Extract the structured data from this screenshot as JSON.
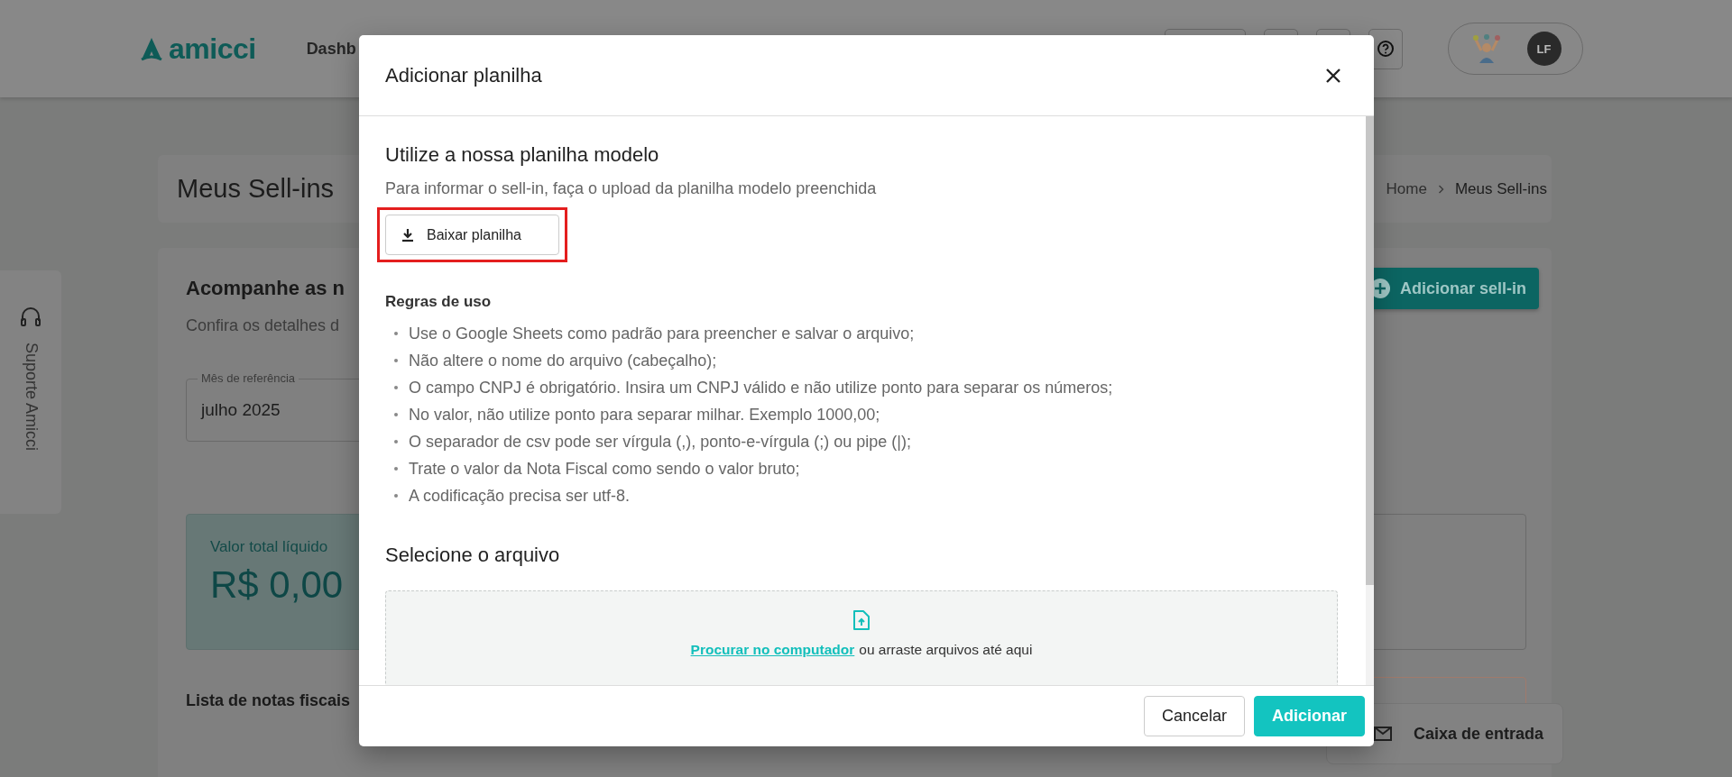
{
  "header": {
    "logo": "amicci",
    "nav": [
      "Dashb"
    ],
    "user": {
      "initials": "LF"
    }
  },
  "support_tab": {
    "label": "Suporte Amicci"
  },
  "page": {
    "title": "Meus Sell-ins",
    "breadcrumb": [
      "Home",
      "Meus Sell-ins"
    ]
  },
  "panel": {
    "heading": "Acompanhe as n",
    "description": "Confira os detalhes d",
    "add_button": "Adicionar sell-in",
    "month_field": {
      "label": "Mês de referência",
      "value": "julho 2025"
    },
    "total_card": {
      "label": "Valor total líquido",
      "value": "R$ 0,00"
    },
    "list_heading": "Lista de notas fiscais"
  },
  "inbox_button": {
    "label": "Caixa de entrada"
  },
  "dialog": {
    "title": "Adicionar planilha",
    "template": {
      "heading": "Utilize a nossa planilha modelo",
      "description": "Para informar o sell-in, faça o upload da planilha modelo preenchida",
      "download_button": "Baixar planilha",
      "highlighted": true
    },
    "rules": {
      "heading": "Regras de uso",
      "items": [
        "Use o Google Sheets como padrão para preencher e salvar o arquivo;",
        "Não altere o nome do arquivo (cabeçalho);",
        "O campo CNPJ é obrigatório. Insira um CNPJ válido e não utilize ponto para separar os números;",
        "No valor, não utilize ponto para separar milhar. Exemplo 1000,00;",
        "O separador de csv pode ser vírgula (,), ponto-e-vírgula (;) ou pipe (|);",
        "Trate o valor da Nota Fiscal como sendo o valor bruto;",
        "A codificação precisa ser utf-8."
      ]
    },
    "file": {
      "heading": "Selecione o arquivo",
      "link": "Procurar no computador",
      "text": "ou arraste arquivos até aqui"
    },
    "buttons": [
      {
        "label": "Cancelar",
        "kind": "secondary"
      },
      {
        "label": "Adicionar",
        "kind": "primary"
      }
    ]
  }
}
